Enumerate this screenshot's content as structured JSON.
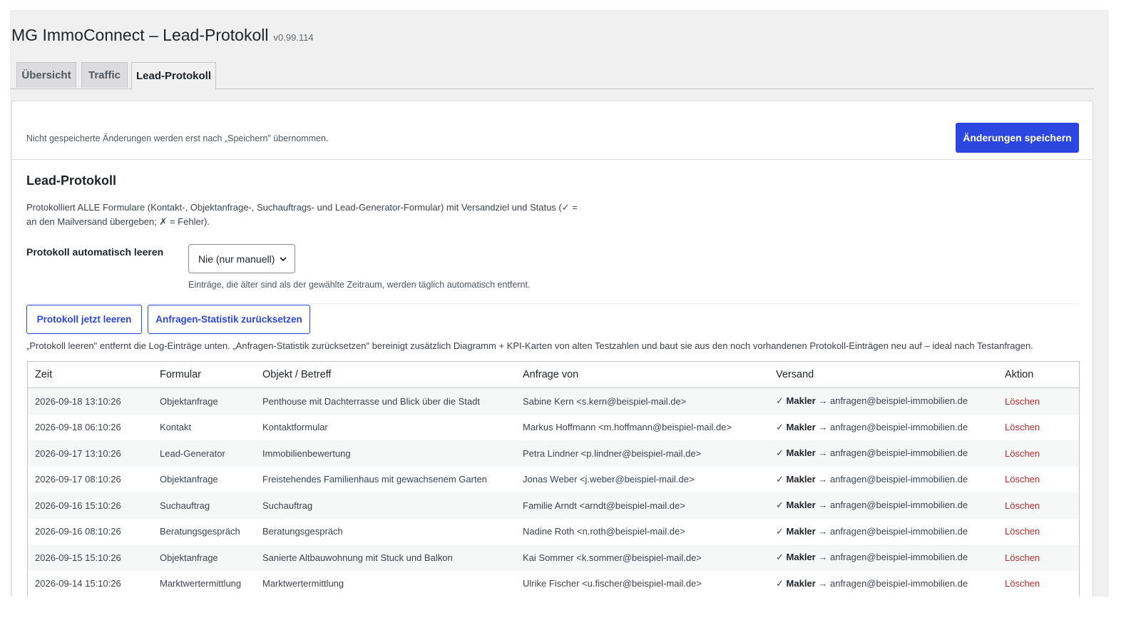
{
  "header": {
    "title": "MG ImmoConnect – Lead-Protokoll",
    "version": "v0.99.114"
  },
  "tabs": [
    {
      "label": "Übersicht",
      "active": false
    },
    {
      "label": "Traffic",
      "active": false
    },
    {
      "label": "Lead-Protokoll",
      "active": true
    }
  ],
  "notice": {
    "text": "Nicht gespeicherte Änderungen werden erst nach „Speichern\" übernommen.",
    "save_label": "Änderungen speichern"
  },
  "section": {
    "title": "Lead-Protokoll",
    "description": "Protokolliert ALLE Formulare (Kontakt-, Objektanfrage-, Suchauftrags- und Lead-Generator-Formular) mit Versandziel und Status (✓ = an den Mailversand übergeben; ✗ = Fehler)."
  },
  "auto_clear": {
    "label": "Protokoll automatisch leeren",
    "selected": "Nie (nur manuell)",
    "help": "Einträge, die älter sind als der gewählte Zeitraum, werden täglich automatisch entfernt."
  },
  "actions": {
    "clear_label": "Protokoll jetzt leeren",
    "reset_label": "Anfragen-Statistik zurücksetzen",
    "help": "„Protokoll leeren\" entfernt die Log-Einträge unten. „Anfragen-Statistik zurücksetzen\" bereinigt zusätzlich Diagramm + KPI-Karten von alten Testzahlen und baut sie aus den noch vorhandenen Protokoll-Einträgen neu auf – ideal nach Testanfragen."
  },
  "table": {
    "columns": [
      "Zeit",
      "Formular",
      "Objekt / Betreff",
      "Anfrage von",
      "Versand",
      "Aktion"
    ],
    "rows": [
      {
        "time": "2026-09-18 13:10:26",
        "form": "Objektanfrage",
        "subject": "Penthouse mit Dachterrasse und Blick über die Stadt",
        "from": "Sabine Kern <s.kern@beispiel-mail.de>",
        "status": "✓",
        "target": "Makler",
        "arrow": "→",
        "email": "anfragen@beispiel-immobilien.de",
        "action": "Löschen"
      },
      {
        "time": "2026-09-18 06:10:26",
        "form": "Kontakt",
        "subject": "Kontaktformular",
        "from": "Markus Hoffmann <m.hoffmann@beispiel-mail.de>",
        "status": "✓",
        "target": "Makler",
        "arrow": "→",
        "email": "anfragen@beispiel-immobilien.de",
        "action": "Löschen"
      },
      {
        "time": "2026-09-17 13:10:26",
        "form": "Lead-Generator",
        "subject": "Immobilienbewertung",
        "from": "Petra Lindner <p.lindner@beispiel-mail.de>",
        "status": "✓",
        "target": "Makler",
        "arrow": "→",
        "email": "anfragen@beispiel-immobilien.de",
        "action": "Löschen"
      },
      {
        "time": "2026-09-17 08:10:26",
        "form": "Objektanfrage",
        "subject": "Freistehendes Familienhaus mit gewachsenem Garten",
        "from": "Jonas Weber <j.weber@beispiel-mail.de>",
        "status": "✓",
        "target": "Makler",
        "arrow": "→",
        "email": "anfragen@beispiel-immobilien.de",
        "action": "Löschen"
      },
      {
        "time": "2026-09-16 15:10:26",
        "form": "Suchauftrag",
        "subject": "Suchauftrag",
        "from": "Familie Arndt <arndt@beispiel-mail.de>",
        "status": "✓",
        "target": "Makler",
        "arrow": "→",
        "email": "anfragen@beispiel-immobilien.de",
        "action": "Löschen"
      },
      {
        "time": "2026-09-16 08:10:26",
        "form": "Beratungsgespräch",
        "subject": "Beratungsgespräch",
        "from": "Nadine Roth <n.roth@beispiel-mail.de>",
        "status": "✓",
        "target": "Makler",
        "arrow": "→",
        "email": "anfragen@beispiel-immobilien.de",
        "action": "Löschen"
      },
      {
        "time": "2026-09-15 15:10:26",
        "form": "Objektanfrage",
        "subject": "Sanierte Altbauwohnung mit Stuck und Balkon",
        "from": "Kai Sommer <k.sommer@beispiel-mail.de>",
        "status": "✓",
        "target": "Makler",
        "arrow": "→",
        "email": "anfragen@beispiel-immobilien.de",
        "action": "Löschen"
      },
      {
        "time": "2026-09-14 15:10:26",
        "form": "Marktwertermittlung",
        "subject": "Marktwertermittlung",
        "from": "Ulrike Fischer <u.fischer@beispiel-mail.de>",
        "status": "✓",
        "target": "Makler",
        "arrow": "→",
        "email": "anfragen@beispiel-immobilien.de",
        "action": "Löschen"
      }
    ]
  }
}
